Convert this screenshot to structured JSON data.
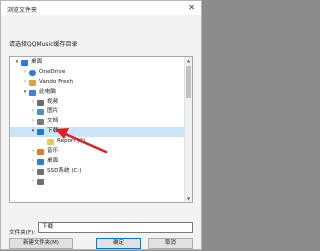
{
  "window": {
    "title": "浏览文件夹",
    "close_symbol": "✕"
  },
  "instruction": "请选择QQMusic缓存目录",
  "tree": {
    "items": [
      {
        "label": "桌面",
        "icon": "desktop-icon",
        "caret": "▾",
        "selected": false
      },
      {
        "label": "OneDrive",
        "icon": "cloud-icon",
        "caret": "›",
        "selected": false
      },
      {
        "label": "Vando Fresh",
        "icon": "user-icon",
        "caret": "›",
        "selected": false
      },
      {
        "label": "此电脑",
        "icon": "computer-icon",
        "caret": "▾",
        "selected": false
      },
      {
        "label": "视频",
        "icon": "video-folder-icon",
        "caret": "›",
        "selected": false
      },
      {
        "label": "图片",
        "icon": "pictures-folder-icon",
        "caret": "›",
        "selected": false
      },
      {
        "label": "文档",
        "icon": "documents-folder-icon",
        "caret": "›",
        "selected": false
      },
      {
        "label": "下载",
        "icon": "downloads-folder-icon",
        "caret": "▾",
        "selected": true
      },
      {
        "label": "Report (2)",
        "icon": "folder-icon",
        "caret": "",
        "selected": false
      },
      {
        "label": "音乐",
        "icon": "music-folder-icon",
        "caret": "›",
        "selected": false
      },
      {
        "label": "桌面",
        "icon": "desktop-folder-icon",
        "caret": "›",
        "selected": false
      },
      {
        "label": "SSD系统 (C:)",
        "icon": "drive-icon",
        "caret": "›",
        "selected": false
      },
      {
        "label": "",
        "icon": "drive-icon",
        "caret": "›",
        "selected": false
      }
    ]
  },
  "folder_field": {
    "label": "文件夹(F):",
    "value": "下载"
  },
  "buttons": {
    "new_folder": "新建文件夹(M)",
    "ok": "确定",
    "cancel": "取消"
  },
  "colors": {
    "selection": "#cce4f7",
    "accent": "#0078d7",
    "annotation_arrow": "#e02020"
  }
}
